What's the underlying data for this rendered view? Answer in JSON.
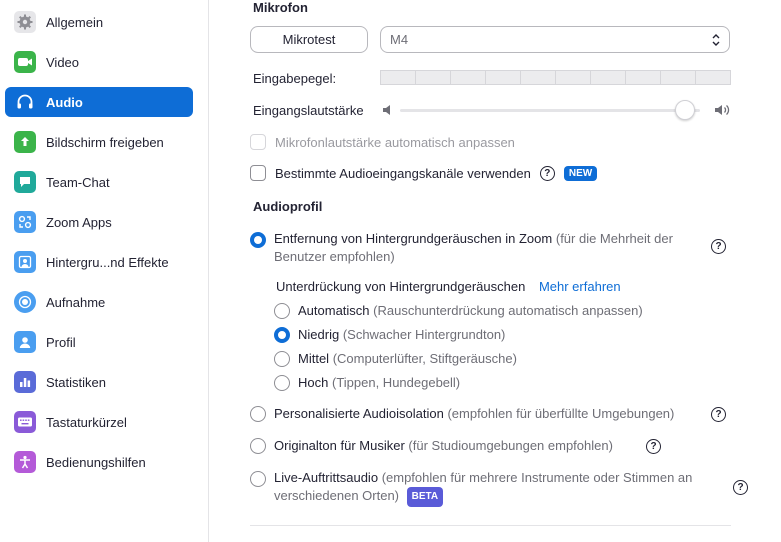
{
  "sidebar": {
    "items": [
      {
        "label": "Allgemein",
        "icon": "gear-icon",
        "color": "#e6e6e9",
        "active": false
      },
      {
        "label": "Video",
        "icon": "video-icon",
        "color": "#3bb44a",
        "active": false
      },
      {
        "label": "Audio",
        "icon": "headphones-icon",
        "color": "#0e6dd6",
        "active": true
      },
      {
        "label": "Bildschirm freigeben",
        "icon": "share-screen-icon",
        "color": "#3bb44a",
        "active": false
      },
      {
        "label": "Team-Chat",
        "icon": "chat-icon",
        "color": "#20a99a",
        "active": false
      },
      {
        "label": "Zoom Apps",
        "icon": "apps-icon",
        "color": "#4a9ef0",
        "active": false
      },
      {
        "label": "Hintergru...nd Effekte",
        "icon": "background-icon",
        "color": "#4a9ef0",
        "active": false
      },
      {
        "label": "Aufnahme",
        "icon": "record-icon",
        "color": "#4a9ef0",
        "active": false
      },
      {
        "label": "Profil",
        "icon": "profile-icon",
        "color": "#4a9ef0",
        "active": false
      },
      {
        "label": "Statistiken",
        "icon": "statistics-icon",
        "color": "#5a6bd8",
        "active": false
      },
      {
        "label": "Tastaturkürzel",
        "icon": "keyboard-icon",
        "color": "#8a5ad8",
        "active": false
      },
      {
        "label": "Bedienungshilfen",
        "icon": "accessibility-icon",
        "color": "#b45ad8",
        "active": false
      }
    ]
  },
  "mic": {
    "title": "Mikrofon",
    "test_button": "Mikrotest",
    "device": "M4",
    "input_level_label": "Eingabepegel:",
    "input_volume_label": "Eingangslautstärke",
    "volume_value": 0.95,
    "auto_adjust_label": "Mikrofonlautstärke automatisch anpassen",
    "auto_adjust_checked": false,
    "channels_label": "Bestimmte Audioeingangskanäle verwenden",
    "new_badge": "NEW",
    "channels_checked": false
  },
  "profile": {
    "title": "Audioprofil",
    "zoom_noise": {
      "main": "Entfernung von Hintergrundgeräuschen in Zoom",
      "sub": "(für die Mehrheit der Benutzer empfohlen)"
    },
    "suppression_label": "Unterdrückung von Hintergrundgeräuschen",
    "learn_more": "Mehr erfahren",
    "levels": [
      {
        "main": "Automatisch",
        "sub": "(Rauschunterdrückung automatisch anpassen)",
        "selected": false
      },
      {
        "main": "Niedrig",
        "sub": "(Schwacher Hintergrundton)",
        "selected": true
      },
      {
        "main": "Mittel",
        "sub": "(Computerlüfter, Stiftgeräusche)",
        "selected": false
      },
      {
        "main": "Hoch",
        "sub": "(Tippen, Hundegebell)",
        "selected": false
      }
    ],
    "personalized": {
      "main": "Personalisierte Audioisolation",
      "sub": "(empfohlen für überfüllte Umgebungen)"
    },
    "original": {
      "main": "Originalton für Musiker",
      "sub": "(für Studioumgebungen empfohlen)"
    },
    "live": {
      "main": "Live-Auftrittsaudio",
      "sub": "(empfohlen für mehrere Instrumente oder Stimmen an verschiedenen Orten)",
      "badge": "BETA"
    }
  },
  "colors": {
    "accent": "#0e6dd6",
    "beta": "#5a5bd8"
  }
}
